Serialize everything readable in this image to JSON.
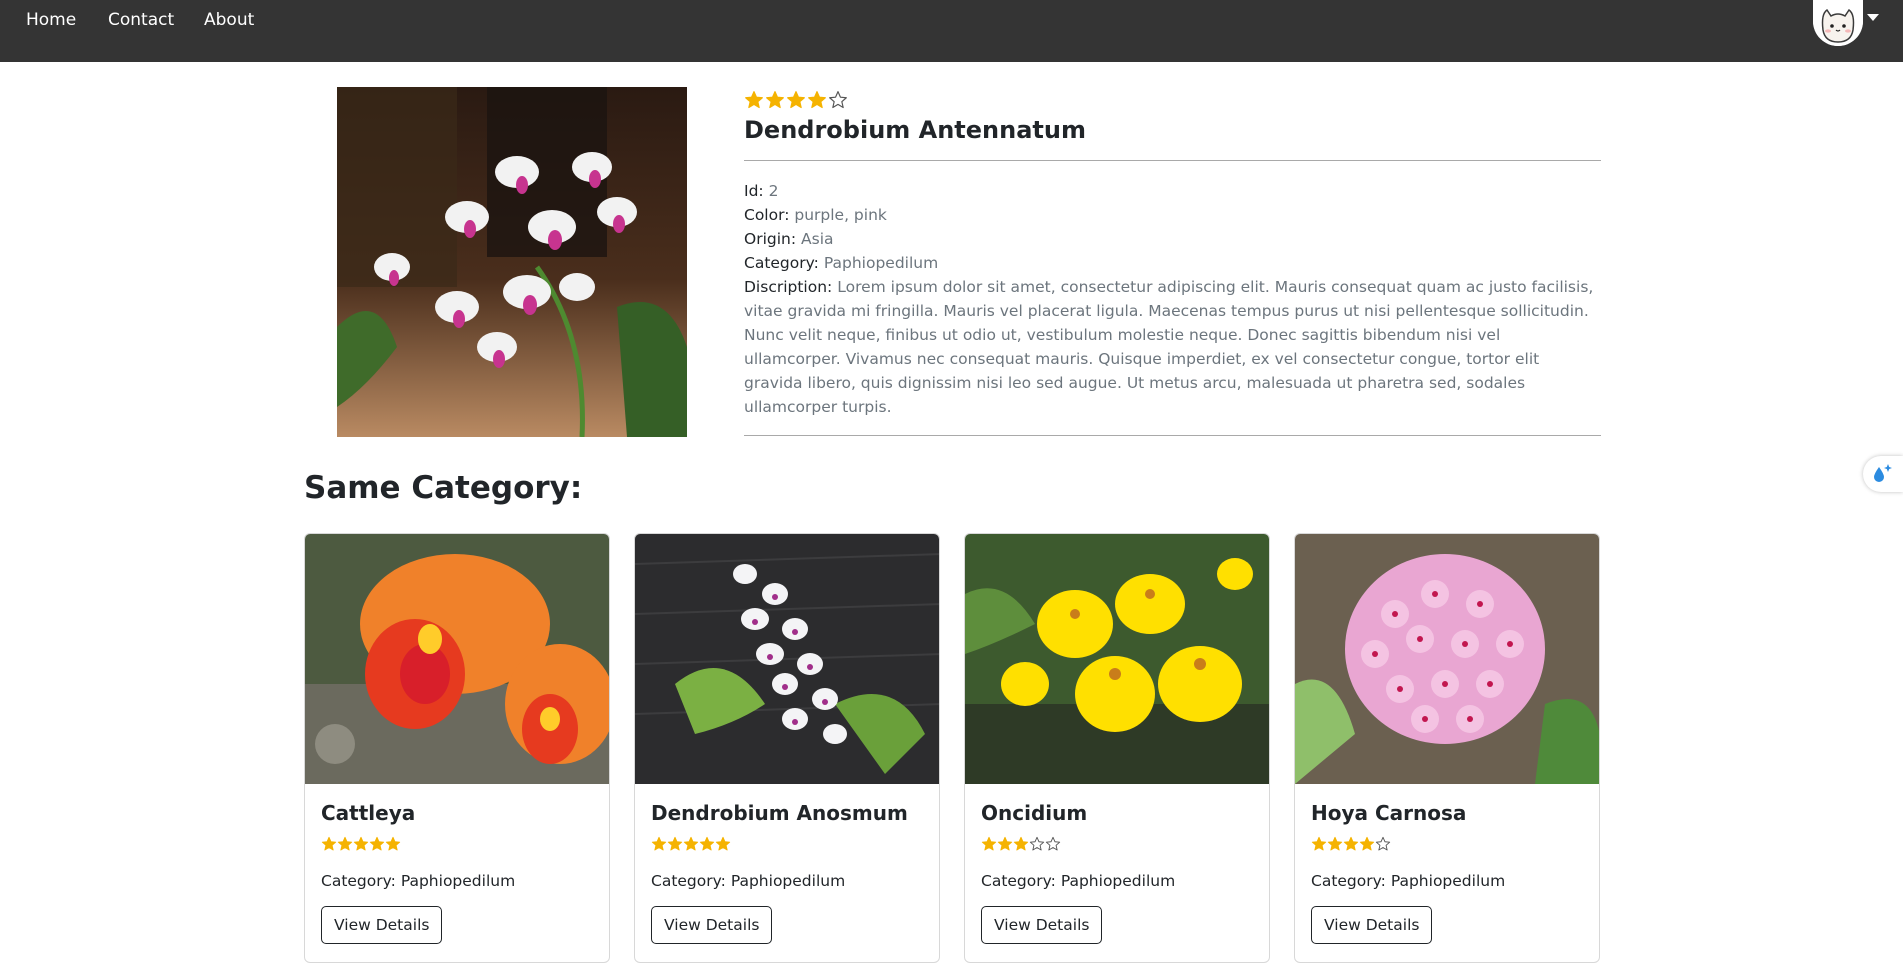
{
  "nav": {
    "links": [
      "Home",
      "Contact",
      "About"
    ]
  },
  "product": {
    "rating": 4,
    "max_rating": 5,
    "title": "Dendrobium Antennatum",
    "fields": [
      {
        "label": "Id:",
        "value": "2"
      },
      {
        "label": "Color:",
        "value": "purple, pink"
      },
      {
        "label": "Origin:",
        "value": "Asia"
      },
      {
        "label": "Category:",
        "value": "Paphiopedilum"
      },
      {
        "label": "Discription:",
        "value": "Lorem ipsum dolor sit amet, consectetur adipiscing elit. Mauris consequat quam ac justo facilisis, vitae gravida mi fringilla. Mauris vel placerat ligula. Maecenas tempus purus ut nisi pellentesque sollicitudin. Nunc velit neque, finibus ut odio ut, vestibulum molestie neque. Donec sagittis bibendum nisi vel ullamcorper. Vivamus nec consequat mauris. Quisque imperdiet, ex vel consectetur congue, tortor elit gravida libero, quis dignissim nisi leo sed augue. Ut metus arcu, malesuada ut pharetra sed, sodales ullamcorper turpis."
      }
    ]
  },
  "related": {
    "heading": "Same Category:",
    "cards": [
      {
        "title": "Cattleya",
        "rating": 5,
        "category_label": "Category: Paphiopedilum",
        "button": "View Details"
      },
      {
        "title": "Dendrobium Anosmum",
        "rating": 5,
        "category_label": "Category: Paphiopedilum",
        "button": "View Details"
      },
      {
        "title": "Oncidium",
        "rating": 3,
        "category_label": "Category: Paphiopedilum",
        "button": "View Details"
      },
      {
        "title": "Hoya Carnosa",
        "rating": 4,
        "category_label": "Category: Paphiopedilum",
        "button": "View Details"
      }
    ]
  },
  "colors": {
    "navbar": "#343434",
    "star": "#f5b301",
    "muted_text": "#6c757d"
  }
}
